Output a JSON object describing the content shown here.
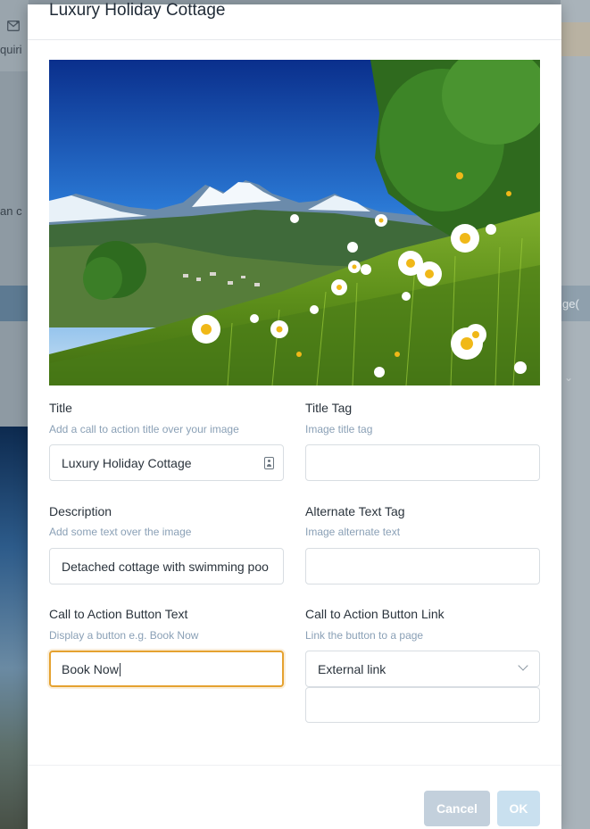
{
  "background": {
    "nav_label": "quiri",
    "left_text": "an c",
    "right_text": "ge(",
    "right_chevron": "⌄"
  },
  "modal": {
    "title": "Luxury Holiday Cottage",
    "fields": {
      "title": {
        "label": "Title",
        "help": "Add a call to action title over your image",
        "value": "Luxury Holiday Cottage"
      },
      "title_tag": {
        "label": "Title Tag",
        "help": "Image title tag",
        "value": ""
      },
      "description": {
        "label": "Description",
        "help": "Add some text over the image",
        "value": "Detached cottage with swimming poo"
      },
      "alt_text": {
        "label": "Alternate Text Tag",
        "help": "Image alternate text",
        "value": ""
      },
      "cta_text": {
        "label": "Call to Action Button Text",
        "help": "Display a button e.g. Book Now",
        "value": "Book Now"
      },
      "cta_link": {
        "label": "Call to Action Button Link",
        "help": "Link the button to a page",
        "selected": "External link",
        "url_value": ""
      }
    },
    "buttons": {
      "cancel": "Cancel",
      "ok": "OK"
    }
  },
  "colors": {
    "focus": "#e5a230",
    "help_text": "#8aa0b6",
    "ok_button": "#c9e0ef",
    "cancel_button": "#c3d0dc"
  },
  "icons": [
    "envelope-icon",
    "contact-card-icon",
    "chevron-down-icon"
  ]
}
